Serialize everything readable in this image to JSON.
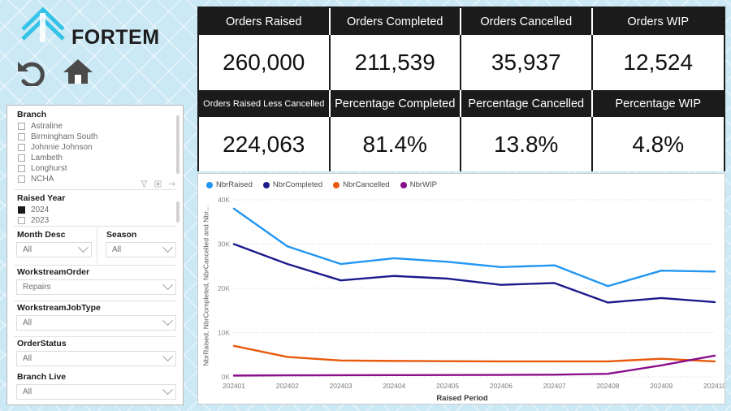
{
  "brand": {
    "name": "FORTEM",
    "logo_icon": "fortem-chevron-logo"
  },
  "nav": {
    "back_icon": "undo-arrow-icon",
    "home_icon": "home-icon"
  },
  "slicers": {
    "branch": {
      "title": "Branch",
      "items": [
        {
          "label": "Astraline",
          "checked": false
        },
        {
          "label": "Birmingham South",
          "checked": false
        },
        {
          "label": "Johnnie Johnson",
          "checked": false
        },
        {
          "label": "Lambeth",
          "checked": false
        },
        {
          "label": "Longhurst",
          "checked": false
        },
        {
          "label": "NCHA",
          "checked": false
        }
      ],
      "tools": [
        "filter-icon",
        "focus-mode-icon",
        "expand-arrow-icon"
      ]
    },
    "raised_year": {
      "title": "Raised Year",
      "items": [
        {
          "label": "2024",
          "checked": true
        },
        {
          "label": "2023",
          "checked": false
        }
      ]
    },
    "month_desc": {
      "label": "Month Desc",
      "value": "All"
    },
    "season": {
      "label": "Season",
      "value": "All"
    },
    "workstream_order": {
      "label": "WorkstreamOrder",
      "value": "Repairs"
    },
    "workstream_job_type": {
      "label": "WorkstreamJobType",
      "value": "All"
    },
    "order_status": {
      "label": "OrderStatus",
      "value": "All"
    },
    "branch_live": {
      "label": "Branch Live",
      "value": "All"
    }
  },
  "kpis": {
    "row1": [
      {
        "title": "Orders Raised",
        "value": "260,000"
      },
      {
        "title": "Orders Completed",
        "value": "211,539"
      },
      {
        "title": "Orders Cancelled",
        "value": "35,937"
      },
      {
        "title": "Orders WIP",
        "value": "12,524"
      }
    ],
    "row2": [
      {
        "title": "Orders Raised Less Cancelled",
        "value": "224,063"
      },
      {
        "title": "Percentage Completed",
        "value": "81.4%"
      },
      {
        "title": "Percentage Cancelled",
        "value": "13.8%"
      },
      {
        "title": "Percentage WIP",
        "value": "4.8%"
      }
    ]
  },
  "chart_data": {
    "type": "line",
    "title": "",
    "xlabel": "Raised Period",
    "ylabel": "NbrRaised, NbrCompleted, NbrCancelled and Nbr...",
    "categories": [
      "202401",
      "202402",
      "202403",
      "202404",
      "202405",
      "202406",
      "202407",
      "202408",
      "202409",
      "202410"
    ],
    "ytick_labels": [
      "0K",
      "10K",
      "20K",
      "30K",
      "40K"
    ],
    "ytick_values": [
      0,
      10000,
      20000,
      30000,
      40000
    ],
    "ylim": [
      0,
      40000
    ],
    "grid": true,
    "legend_position": "top-left",
    "series": [
      {
        "name": "NbrRaised",
        "color": "#2196f3",
        "values": [
          38000,
          29500,
          25500,
          26800,
          26000,
          24800,
          25200,
          20500,
          24000,
          23800
        ]
      },
      {
        "name": "NbrCompleted",
        "color": "#1a1a8c",
        "values": [
          30000,
          25500,
          21800,
          22800,
          22200,
          20800,
          21200,
          16800,
          17800,
          16900
        ]
      },
      {
        "name": "NbrCancelled",
        "color": "#e8590c",
        "values": [
          7000,
          4500,
          3700,
          3600,
          3550,
          3500,
          3500,
          3500,
          4100,
          3500
        ]
      },
      {
        "name": "NbrWIP",
        "color": "#8b0f8b",
        "values": [
          300,
          350,
          380,
          400,
          420,
          450,
          500,
          700,
          2600,
          4800
        ]
      }
    ]
  }
}
